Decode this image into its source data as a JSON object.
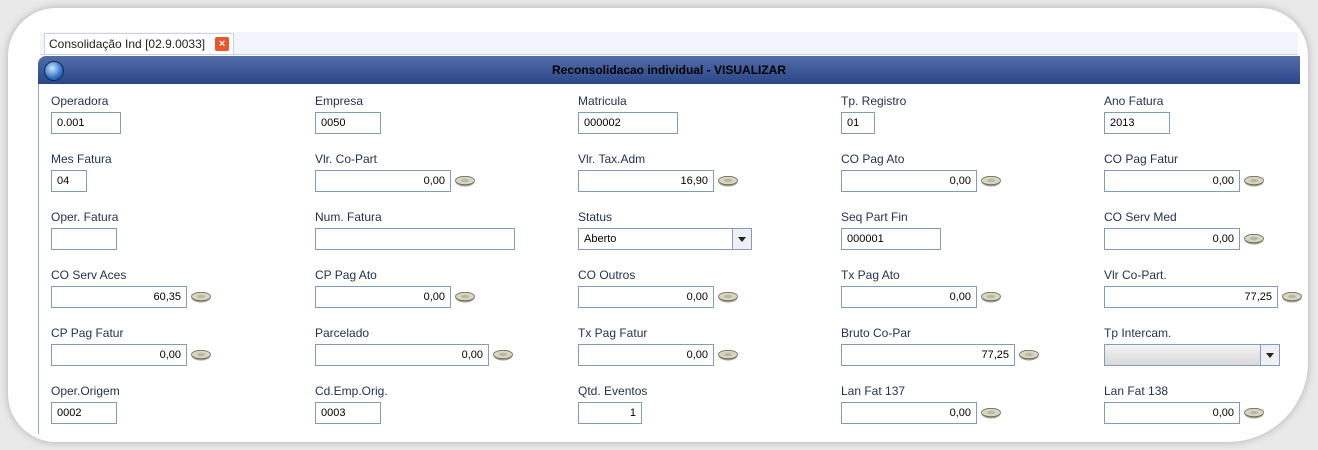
{
  "tab": {
    "label": "Consolidação Ind [02.9.0033]"
  },
  "window": {
    "title": "Reconsolidacao individual - VISUALIZAR"
  },
  "icons": {
    "money": "money-icon",
    "globe": "globe-icon",
    "close": "close-icon"
  },
  "fields": {
    "operadora": {
      "label": "Operadora",
      "value": "0.001"
    },
    "empresa": {
      "label": "Empresa",
      "value": "0050"
    },
    "matricula": {
      "label": "Matricula",
      "value": "000002"
    },
    "tp_registro": {
      "label": "Tp. Registro",
      "value": "01"
    },
    "ano_fatura": {
      "label": "Ano Fatura",
      "value": "2013"
    },
    "mes_fatura": {
      "label": "Mes Fatura",
      "value": "04"
    },
    "vlr_co_part": {
      "label": "Vlr. Co-Part",
      "value": "0,00"
    },
    "vlr_tax_adm": {
      "label": "Vlr. Tax.Adm",
      "value": "16,90"
    },
    "co_pag_ato": {
      "label": "CO Pag Ato",
      "value": "0,00"
    },
    "co_pag_fatur": {
      "label": "CO Pag Fatur",
      "value": "0,00"
    },
    "oper_fatura": {
      "label": "Oper. Fatura",
      "value": ""
    },
    "num_fatura": {
      "label": "Num. Fatura",
      "value": ""
    },
    "status": {
      "label": "Status",
      "value": "Aberto"
    },
    "seq_part_fin": {
      "label": "Seq Part Fin",
      "value": "000001"
    },
    "co_serv_med": {
      "label": "CO Serv Med",
      "value": "0,00"
    },
    "co_serv_aces": {
      "label": "CO Serv Aces",
      "value": "60,35"
    },
    "cp_pag_ato": {
      "label": "CP Pag Ato",
      "value": "0,00"
    },
    "co_outros": {
      "label": "CO Outros",
      "value": "0,00"
    },
    "tx_pag_ato": {
      "label": "Tx Pag Ato",
      "value": "0,00"
    },
    "vlr_co_part2": {
      "label": "Vlr Co-Part.",
      "value": "77,25"
    },
    "cp_pag_fatur": {
      "label": "CP Pag Fatur",
      "value": "0,00"
    },
    "parcelado": {
      "label": "Parcelado",
      "value": "0,00"
    },
    "tx_pag_fatur": {
      "label": "Tx Pag Fatur",
      "value": "0,00"
    },
    "bruto_co_par": {
      "label": "Bruto Co-Par",
      "value": "77,25"
    },
    "tp_intercam": {
      "label": "Tp Intercam.",
      "value": ""
    },
    "oper_origem": {
      "label": "Oper.Origem",
      "value": "0002"
    },
    "cd_emp_orig": {
      "label": "Cd.Emp.Orig.",
      "value": "0003"
    },
    "qtd_eventos": {
      "label": "Qtd. Eventos",
      "value": "1"
    },
    "lan_fat_137": {
      "label": "Lan Fat 137",
      "value": "0,00"
    },
    "lan_fat_138": {
      "label": "Lan Fat 138",
      "value": "0,00"
    }
  }
}
